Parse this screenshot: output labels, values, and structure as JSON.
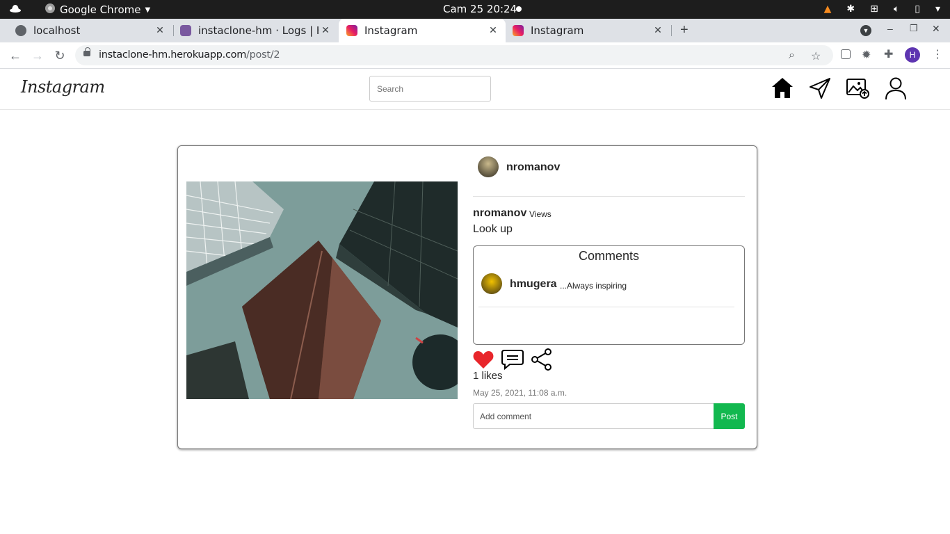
{
  "system_bar": {
    "app_name": "Google Chrome",
    "clock": "Cam 25  20:24"
  },
  "tabs": [
    {
      "title": "localhost"
    },
    {
      "title": "instaclone-hm · Logs | Her"
    },
    {
      "title": "Instagram"
    },
    {
      "title": "Instagram"
    }
  ],
  "address_bar": {
    "domain": "instaclone-hm.herokuapp.com",
    "path": "/post/2"
  },
  "profile_initial": "H",
  "instagram": {
    "logo": "Instagram",
    "search_placeholder": "Search",
    "nav_icons": [
      "home-icon",
      "send-icon",
      "upload-image-icon",
      "profile-icon"
    ]
  },
  "post": {
    "author": "nromanov",
    "caption_user": "nromanov",
    "caption_views": "Views",
    "caption": "Look up",
    "comments_title": "Comments",
    "comments": [
      {
        "user": "hmugera",
        "text": "...Always inspiring"
      }
    ],
    "likes": "1 likes",
    "timestamp": "May 25, 2021, 11:08 a.m.",
    "comment_placeholder": "Add comment",
    "post_button": "Post",
    "liked": true
  },
  "colors": {
    "like_red": "#e8262b",
    "post_green": "#12b84f",
    "chrome_tabstrip": "#dee1e6"
  }
}
